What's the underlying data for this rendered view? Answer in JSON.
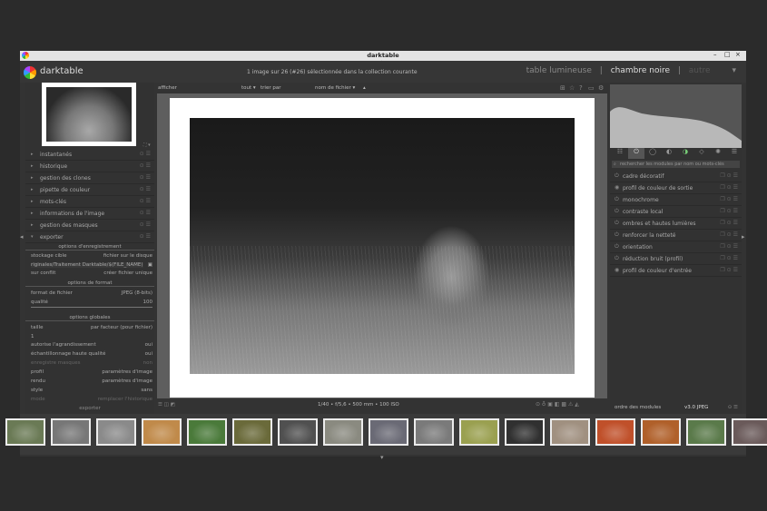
{
  "window": {
    "title": "darktable",
    "minimize": "–",
    "maximize": "□",
    "close": "×"
  },
  "header": {
    "app_name": "darktable",
    "info": "1 image sur 26 (#26) sélectionnée dans la collection courante",
    "views": {
      "lighttable": "table lumineuse",
      "separator": "|",
      "darkroom": "chambre noire",
      "other": "autre",
      "dropdown": "▾"
    }
  },
  "left": {
    "modules": [
      {
        "arrow": "▸",
        "label": "instantanés"
      },
      {
        "arrow": "▸",
        "label": "historique"
      },
      {
        "arrow": "▸",
        "label": "gestion des clones"
      },
      {
        "arrow": "▸",
        "label": "pipette de couleur"
      },
      {
        "arrow": "▸",
        "label": "mots-clés"
      },
      {
        "arrow": "▸",
        "label": "informations de l'image"
      },
      {
        "arrow": "▸",
        "label": "gestion des masques"
      },
      {
        "arrow": "▾",
        "label": "exporter"
      }
    ],
    "export": {
      "sec_storage": "options d'enregistrement",
      "storage_label": "stockage cible",
      "storage_value": "fichier sur le disque",
      "path": "riginales/Traitement Darktable/$(FILE_NAME)",
      "conflict_label": "sur conflit",
      "conflict_value": "créer fichier unique",
      "sec_format": "options de format",
      "format_label": "format de fichier",
      "format_value": "JPEG (8-bits)",
      "quality_label": "qualité",
      "quality_value": "100",
      "sec_global": "options globales",
      "size_label": "taille",
      "size_value": "par facteur (pour fichier)",
      "size_factor": "1",
      "upscale_label": "autorise l'agrandissement",
      "upscale_value": "oui",
      "hq_label": "échantillonnage haute qualité",
      "hq_value": "oui",
      "masks_label": "enregistre masques",
      "masks_value": "non",
      "profile_label": "profil",
      "profile_value": "paramètres d'image",
      "intent_label": "rendu",
      "intent_value": "paramètres d'image",
      "style_label": "style",
      "style_value": "sans",
      "mode_label": "mode",
      "mode_value": "remplacer l'historique",
      "export_button": "exporter"
    }
  },
  "center": {
    "toolbar": {
      "show": "afficher",
      "filter": "tout",
      "sort_label": "trier par",
      "sort_value": "nom de fichier",
      "sort_dir": "▴"
    },
    "exif": "1/40 • f/5,6 • 500 mm • 100 ISO"
  },
  "right": {
    "search_placeholder": "rechercher les modules par nom ou mots-clés",
    "modules": [
      {
        "label": "cadre décoratif"
      },
      {
        "label": "profil de couleur de sortie"
      },
      {
        "label": "monochrome"
      },
      {
        "label": "contraste local"
      },
      {
        "label": "ombres et hautes lumières"
      },
      {
        "label": "renforcer la netteté"
      },
      {
        "label": "orientation"
      },
      {
        "label": "réduction bruit (profil)"
      },
      {
        "label": "profil de couleur d'entrée"
      }
    ],
    "footer_label": "ordre des modules",
    "footer_value": "v3.0 JPEG"
  },
  "filmstrip": {
    "colors": [
      "#6a7a55",
      "#777777",
      "#8a8a8a",
      "#c08a4a",
      "#4a7a3a",
      "#6a6a3a",
      "#505050",
      "#8a8a80",
      "#6a6a75",
      "#7a7a7a",
      "#9aa050",
      "#303030",
      "#a09080",
      "#c0502a",
      "#b0602a",
      "#5a7a4a",
      "#6a5a5a"
    ]
  },
  "colors": {
    "accent": "#2b2b2b"
  }
}
